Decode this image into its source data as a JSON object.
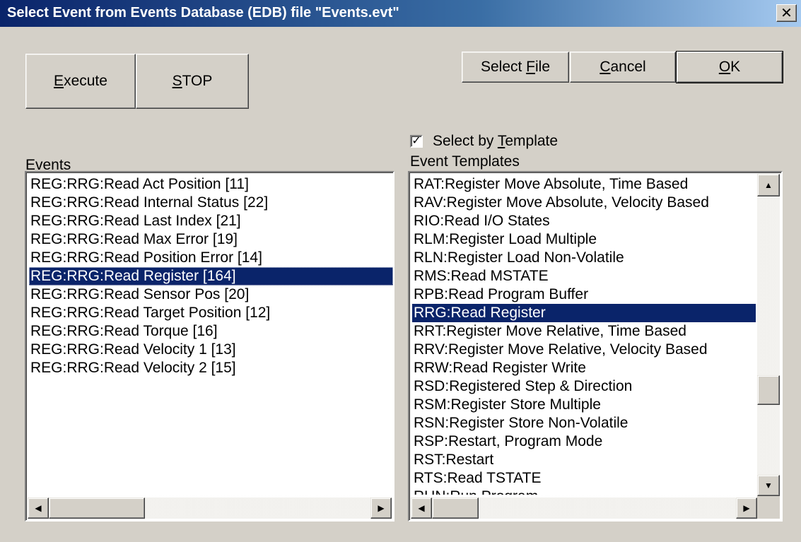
{
  "window": {
    "title": "Select Event from Events Database (EDB) file \"Events.evt\"",
    "close_glyph": "✕"
  },
  "buttons": {
    "execute": {
      "prefix": "",
      "accel": "E",
      "suffix": "xecute"
    },
    "stop": {
      "prefix": "",
      "accel": "S",
      "suffix": "TOP"
    },
    "select_file": {
      "prefix": "Select ",
      "accel": "F",
      "suffix": "ile"
    },
    "cancel": {
      "prefix": "",
      "accel": "C",
      "suffix": "ancel"
    },
    "ok": {
      "prefix": "",
      "accel": "O",
      "suffix": "K"
    }
  },
  "select_by_template": {
    "checked": true,
    "check_glyph": "✓",
    "label_prefix": "Select by ",
    "label_accel": "T",
    "label_suffix": "emplate"
  },
  "events": {
    "label": "Events",
    "items": [
      "REG:RRG:Read Act Position [11]",
      "REG:RRG:Read Internal Status [22]",
      "REG:RRG:Read Last Index [21]",
      "REG:RRG:Read Max Error [19]",
      "REG:RRG:Read Position Error [14]",
      "REG:RRG:Read Register [164]",
      "REG:RRG:Read Sensor Pos [20]",
      "REG:RRG:Read Target Position [12]",
      "REG:RRG:Read Torque [16]",
      "REG:RRG:Read Velocity 1 [13]",
      "REG:RRG:Read Velocity 2 [15]"
    ],
    "selected_index": 5
  },
  "templates": {
    "label": "Event Templates",
    "items": [
      "RAT:Register Move Absolute, Time Based",
      "RAV:Register Move Absolute, Velocity Based",
      "RIO:Read I/O States",
      "RLM:Register Load Multiple",
      "RLN:Register Load Non-Volatile",
      "RMS:Read MSTATE",
      "RPB:Read Program Buffer",
      "RRG:Read Register",
      "RRT:Register Move Relative, Time Based",
      "RRV:Register Move Relative, Velocity Based",
      "RRW:Read Register Write",
      "RSD:Registered Step & Direction",
      "RSM:Register Store Multiple",
      "RSN:Register Store Non-Volatile",
      "RSP:Restart, Program Mode",
      "RST:Restart",
      "RTS:Read TSTATE",
      "RUN:Run Program"
    ],
    "selected_index": 7,
    "vertical_scroll_fraction": 0.72
  },
  "scroll_glyphs": {
    "up": "▲",
    "down": "▼",
    "left": "◀",
    "right": "▶"
  },
  "colors": {
    "selection": "#0a246a",
    "face": "#d4d0c8"
  }
}
